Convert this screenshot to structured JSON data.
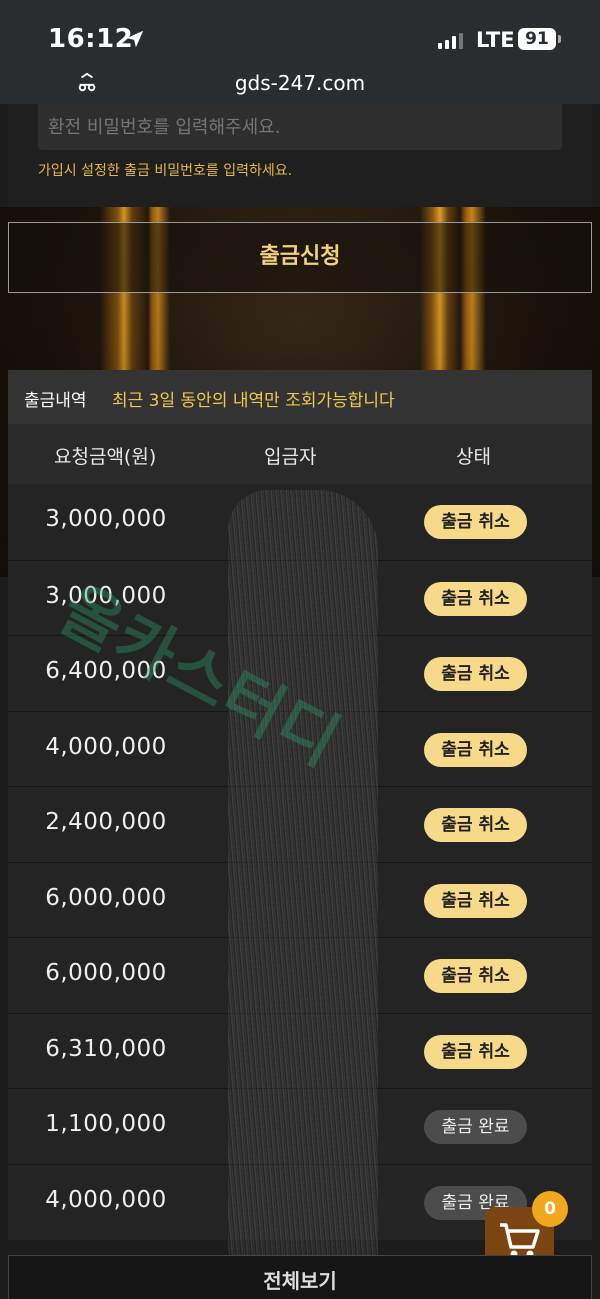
{
  "status_bar": {
    "time": "16:12",
    "network": "LTE",
    "battery": "91"
  },
  "browser": {
    "url": "gds-247.com"
  },
  "password_form": {
    "placeholder": "환전 비밀번호를 입력해주세요.",
    "hint": "가입시 설정한 출금 비밀번호를 입력하세요."
  },
  "submit_label": "출금신청",
  "history": {
    "title": "출금내역",
    "note": "최근 3일 동안의 내역만 조회가능합니다",
    "columns": {
      "amount": "요청금액(원)",
      "depositor": "입금자",
      "status": "상태"
    },
    "rows": [
      {
        "amount": "3,000,000",
        "status": "출금 취소",
        "status_type": "cancel"
      },
      {
        "amount": "3,000,000",
        "status": "출금 취소",
        "status_type": "cancel"
      },
      {
        "amount": "6,400,000",
        "status": "출금 취소",
        "status_type": "cancel"
      },
      {
        "amount": "4,000,000",
        "status": "출금 취소",
        "status_type": "cancel"
      },
      {
        "amount": "2,400,000",
        "status": "출금 취소",
        "status_type": "cancel"
      },
      {
        "amount": "6,000,000",
        "status": "출금 취소",
        "status_type": "cancel"
      },
      {
        "amount": "6,000,000",
        "status": "출금 취소",
        "status_type": "cancel"
      },
      {
        "amount": "6,310,000",
        "status": "출금 취소",
        "status_type": "cancel"
      },
      {
        "amount": "1,100,000",
        "status": "출금 완료",
        "status_type": "done"
      },
      {
        "amount": "4,000,000",
        "status": "출금 완료",
        "status_type": "done"
      }
    ]
  },
  "watermark": "올카스터디",
  "cart": {
    "count": "0",
    "icon": "cart-icon"
  },
  "view_all_label": "전체보기",
  "colors": {
    "accent": "#f1c84b",
    "badge_cancel": "#f7d98a",
    "badge_done": "#4c4c4c",
    "cart_bg": "#7a4510",
    "cart_badge": "#f1a81f"
  }
}
